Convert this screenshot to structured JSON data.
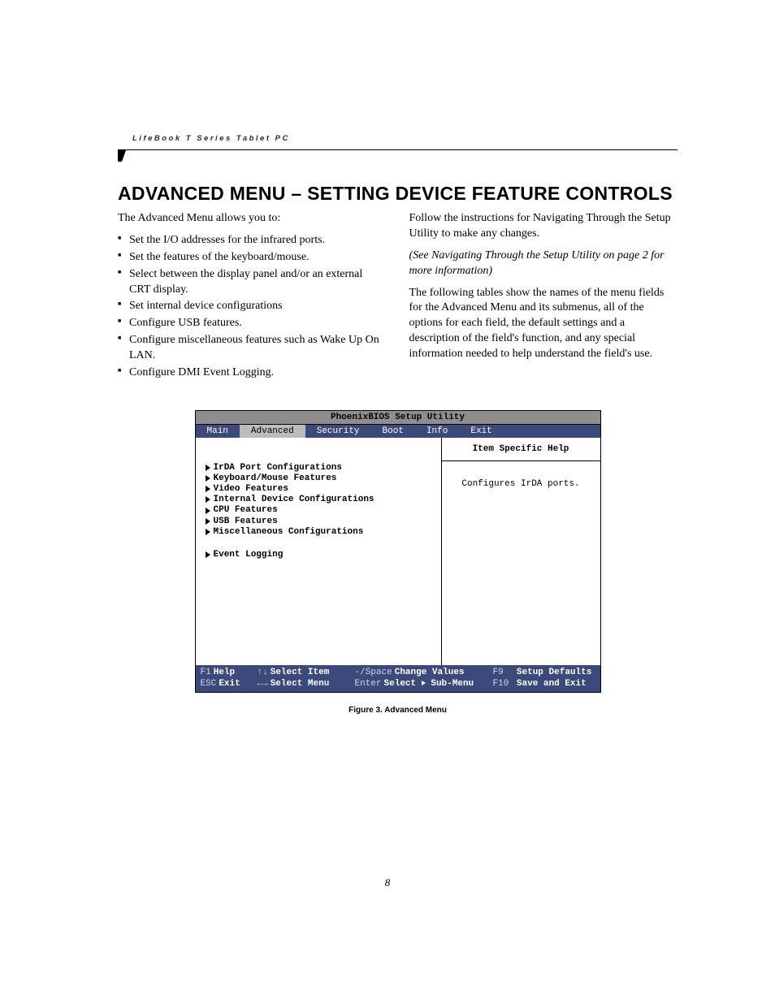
{
  "running_head": "LifeBook T Series Tablet PC",
  "title": "ADVANCED MENU – SETTING DEVICE FEATURE CONTROLS",
  "left_intro": "The Advanced Menu allows you to:",
  "bullets": [
    "Set the I/O addresses for the infrared ports.",
    "Set the features of the keyboard/mouse.",
    "Select between the display panel and/or an external CRT display.",
    "Set internal device configurations",
    "Configure USB features.",
    "Configure miscellaneous features such as Wake Up On LAN.",
    "Configure DMI Event Logging."
  ],
  "right_p1": "Follow the instructions for Navigating Through the Setup Utility to make any changes.",
  "right_p2": "(See Navigating Through the Setup Utility on page 2 for more information)",
  "right_p3": "The following tables show the names of the menu fields for the Advanced Menu and its submenus, all of the options for each field, the default settings and a description of the field's function, and any special information needed to help understand the field's use.",
  "bios": {
    "title": "PhoenixBIOS Setup Utility",
    "tabs": [
      "Main",
      "Advanced",
      "Security",
      "Boot",
      "Info",
      "Exit"
    ],
    "active_tab": "Advanced",
    "items": [
      "IrDA Port Configurations",
      "Keyboard/Mouse Features",
      "Video Features",
      "Internal Device Configurations",
      "CPU Features",
      "USB Features",
      "Miscellaneous Configurations"
    ],
    "item_gap": "Event Logging",
    "help_title": "Item Specific Help",
    "help_text": "Configures IrDA ports.",
    "footer": {
      "f1": "F1",
      "help": "Help",
      "updown": "↑↓",
      "select_item": "Select Item",
      "minus_space": "-/Space",
      "change_values": "Change Values",
      "f9": "F9",
      "setup_defaults": "Setup Defaults",
      "esc": "ESC",
      "exit": "Exit",
      "leftright": "←→",
      "select_menu": "Select Menu",
      "enter": "Enter",
      "select_sub": "Select",
      "submenu": "Sub-Menu",
      "f10": "F10",
      "save_exit": "Save and Exit"
    }
  },
  "figure_caption": "Figure 3.   Advanced Menu",
  "page_number": "8"
}
